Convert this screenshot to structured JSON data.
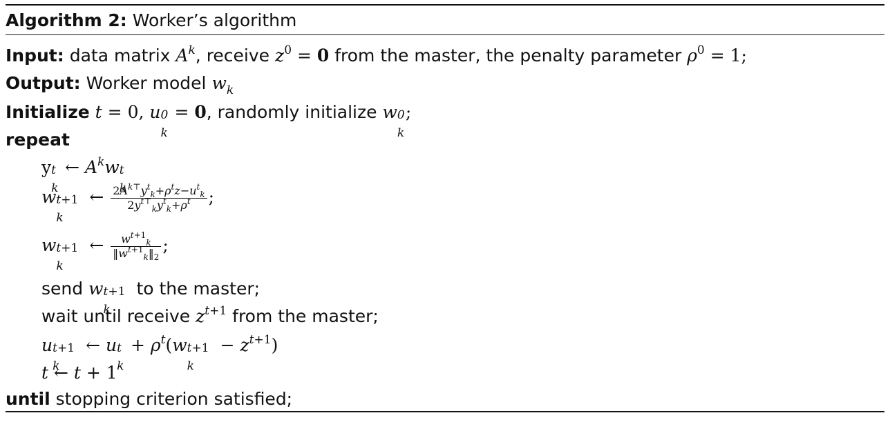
{
  "caption": {
    "label": "Algorithm 2:",
    "title": "Worker’s algorithm"
  },
  "input": {
    "keyword": "Input:",
    "text_a": "data matrix",
    "text_b": ", receive",
    "text_c": "from the master, the penalty parameter"
  },
  "output": {
    "keyword": "Output:",
    "text": "Worker model"
  },
  "initialize": {
    "keyword": "Initialize",
    "text": ", randomly initialize"
  },
  "repeat_keyword": "repeat",
  "steps": {
    "send": "send",
    "send_tail": "to the master;",
    "wait": "wait until receive",
    "wait_tail": "from the master;"
  },
  "until": {
    "keyword": "until",
    "text": "stopping criterion satisfied;"
  }
}
